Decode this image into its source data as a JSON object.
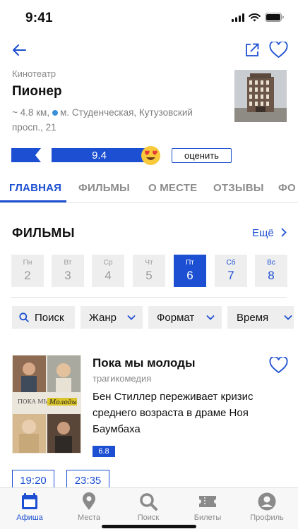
{
  "status_bar": {
    "time": "9:41"
  },
  "cinema": {
    "type": "Кинотеатр",
    "name": "Пионер",
    "distance": "~ 4.8 км,",
    "address": "м. Студенческая, Кутузовский просп., 21",
    "rating": "9.4",
    "rate_label": "оценить"
  },
  "tabs": [
    {
      "label": "ГЛАВНАЯ",
      "active": true
    },
    {
      "label": "ФИЛЬМЫ"
    },
    {
      "label": "О МЕСТЕ"
    },
    {
      "label": "ОТЗЫВЫ"
    },
    {
      "label": "ФО"
    }
  ],
  "films_section": {
    "title": "ФИЛЬМЫ",
    "more_label": "Ещё"
  },
  "days": [
    {
      "name": "Пн",
      "num": "2"
    },
    {
      "name": "Вт",
      "num": "3"
    },
    {
      "name": "Ср",
      "num": "4"
    },
    {
      "name": "Чт",
      "num": "5"
    },
    {
      "name": "Пт",
      "num": "6",
      "active": true
    },
    {
      "name": "Сб",
      "num": "7",
      "weekend": true
    },
    {
      "name": "Вс",
      "num": "8",
      "weekend": true
    }
  ],
  "filters": {
    "search": "Поиск",
    "genre": "Жанр",
    "format": "Формат",
    "time": "Время"
  },
  "movie": {
    "title": "Пока мы молоды",
    "genre": "трагикомедия",
    "description": "Бен Стиллер переживает кризис среднего возраста в драме Ноя Баумбаха",
    "rating": "6.8",
    "poster_text_1": "ПОКА МЫ",
    "poster_text_2": "Молоды",
    "sessions": [
      "19:20",
      "23:35"
    ]
  },
  "tabbar": [
    {
      "label": "Афиша",
      "icon": "calendar-icon",
      "active": true
    },
    {
      "label": "Места",
      "icon": "map-pin-icon"
    },
    {
      "label": "Поиск",
      "icon": "search-icon"
    },
    {
      "label": "Билеты",
      "icon": "ticket-icon"
    },
    {
      "label": "Профиль",
      "icon": "profile-icon"
    }
  ],
  "colors": {
    "accent": "#1c4fd1",
    "metro_line": "#3b8fd6",
    "muted": "#8a8a8a",
    "chip_bg": "#eeeeee"
  }
}
